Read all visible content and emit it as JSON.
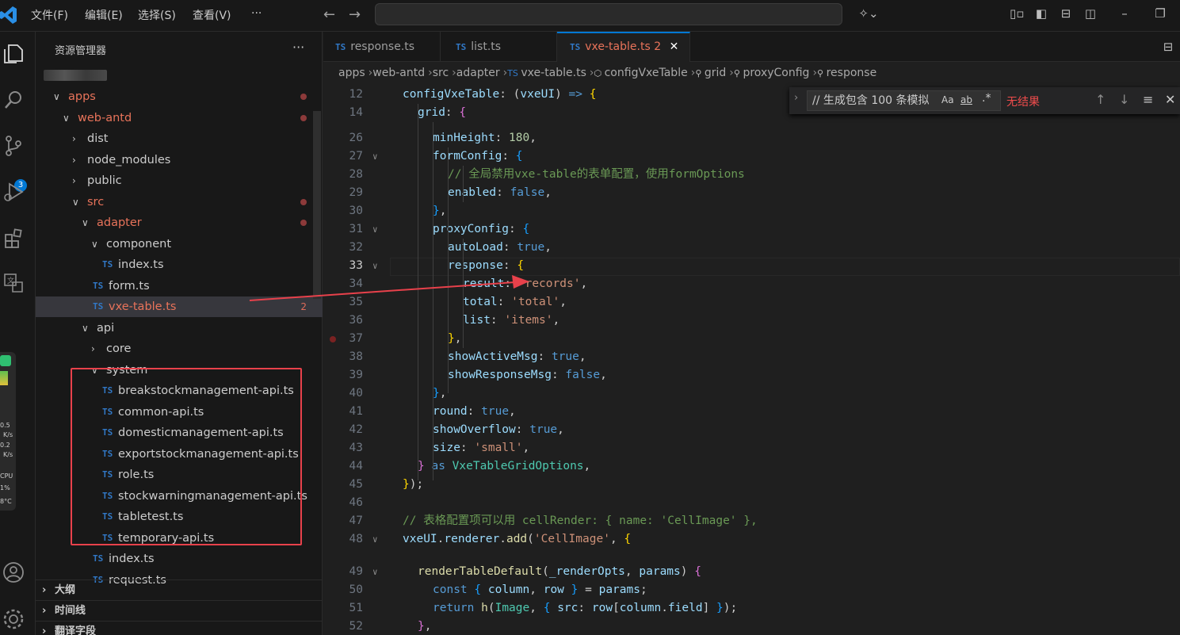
{
  "menu": [
    "文件(F)",
    "编辑(E)",
    "选择(S)",
    "查看(V)",
    "···"
  ],
  "nav": {
    "back": "←",
    "forward": "→"
  },
  "activity_badge": "3",
  "widget": [
    "0.5",
    "K/s",
    "0.2",
    "K/s",
    "CPU",
    "1%",
    "8°C"
  ],
  "sidebar": {
    "title": "资源管理器",
    "more": "···",
    "tree": [
      {
        "label": "apps",
        "chev": "∨",
        "indent": 0,
        "modified": true,
        "dot": true
      },
      {
        "label": "web-antd",
        "chev": "∨",
        "indent": 1,
        "modified": true,
        "dot": true
      },
      {
        "label": "dist",
        "chev": "›",
        "indent": 2
      },
      {
        "label": "node_modules",
        "chev": "›",
        "indent": 2
      },
      {
        "label": "public",
        "chev": "›",
        "indent": 2
      },
      {
        "label": "src",
        "chev": "∨",
        "indent": 2,
        "modified": true,
        "dot": true
      },
      {
        "label": "adapter",
        "chev": "∨",
        "indent": 3,
        "modified": true,
        "dot": true
      },
      {
        "label": "component",
        "chev": "∨",
        "indent": 4
      },
      {
        "label": "index.ts",
        "ts": true,
        "indent": 5
      },
      {
        "label": "form.ts",
        "ts": true,
        "indent": 4
      },
      {
        "label": "vxe-table.ts",
        "ts": true,
        "indent": 4,
        "modified": true,
        "count": "2",
        "selected": true
      },
      {
        "label": "api",
        "chev": "∨",
        "indent": 3
      },
      {
        "label": "core",
        "chev": "›",
        "indent": 4
      },
      {
        "label": "system",
        "chev": "∨",
        "indent": 4
      },
      {
        "label": "breakstockmanagement-api.ts",
        "ts": true,
        "indent": 5
      },
      {
        "label": "common-api.ts",
        "ts": true,
        "indent": 5
      },
      {
        "label": "domesticmanagement-api.ts",
        "ts": true,
        "indent": 5
      },
      {
        "label": "exportstockmanagement-api.ts",
        "ts": true,
        "indent": 5
      },
      {
        "label": "role.ts",
        "ts": true,
        "indent": 5
      },
      {
        "label": "stockwarningmanagement-api.ts",
        "ts": true,
        "indent": 5
      },
      {
        "label": "tabletest.ts",
        "ts": true,
        "indent": 5
      },
      {
        "label": "temporary-api.ts",
        "ts": true,
        "indent": 5
      },
      {
        "label": "index.ts",
        "ts": true,
        "indent": 4
      },
      {
        "label": "request.ts",
        "ts": true,
        "indent": 4
      }
    ],
    "sections": [
      "大纲",
      "时间线",
      "翻译字段"
    ]
  },
  "tabs": [
    {
      "label": "response.ts",
      "active": false
    },
    {
      "label": "list.ts",
      "active": false
    },
    {
      "label": "vxe-table.ts",
      "active": true,
      "count": "2",
      "close": "✕"
    }
  ],
  "breadcrumb": [
    "apps",
    "web-antd",
    "src",
    "adapter",
    "vxe-table.ts",
    "configVxeTable",
    "grid",
    "proxyConfig",
    "response"
  ],
  "find": {
    "query": "// 生成包含 100 条模拟",
    "opt_case": "Aa",
    "opt_word": "ab",
    "opt_regex": ".*",
    "result": "无结果"
  },
  "code": [
    {
      "n": "12",
      "fold": false,
      "indent": 0,
      "html": "<span class='prop'>configVxeTable</span>: (<span class='prop'>vxeUI</span>) <span class='kw'>=&gt;</span> <span class='br1'>{</span>"
    },
    {
      "n": "14",
      "fold": false,
      "indent": 1,
      "html": "<span class='prop'>grid</span>: <span class='br2'>{</span>"
    },
    {
      "n": "26",
      "fold": false,
      "indent": 2,
      "html": "<span class='prop'>minHeight</span>: <span class='num'>180</span>,"
    },
    {
      "n": "27",
      "fold": true,
      "indent": 2,
      "html": "<span class='prop'>formConfig</span>: <span class='br3'>{</span>"
    },
    {
      "n": "28",
      "fold": false,
      "indent": 3,
      "html": "<span class='cmt'>// 全局禁用vxe-table的表单配置，使用formOptions</span>"
    },
    {
      "n": "29",
      "fold": false,
      "indent": 3,
      "html": "<span class='prop'>enabled</span>: <span class='kw'>false</span>,"
    },
    {
      "n": "30",
      "fold": false,
      "indent": 2,
      "html": "<span class='br3'>}</span>,"
    },
    {
      "n": "31",
      "fold": true,
      "indent": 2,
      "html": "<span class='prop'>proxyConfig</span>: <span class='br3'>{</span>"
    },
    {
      "n": "32",
      "fold": false,
      "indent": 3,
      "html": "<span class='prop'>autoLoad</span>: <span class='kw'>true</span>,"
    },
    {
      "n": "33",
      "fold": true,
      "indent": 3,
      "cur": true,
      "html": "<span class='prop'>response</span>: <span class='br1'>{</span>"
    },
    {
      "n": "34",
      "fold": false,
      "indent": 4,
      "html": "<span class='prop'>result</span>: <span class='str'>'records'</span>,"
    },
    {
      "n": "35",
      "fold": false,
      "indent": 4,
      "html": "<span class='prop'>total</span>: <span class='str'>'total'</span>,"
    },
    {
      "n": "36",
      "fold": false,
      "indent": 4,
      "html": "<span class='prop'>list</span>: <span class='str'>'items'</span>,"
    },
    {
      "n": "37",
      "fold": false,
      "indent": 3,
      "html": "<span class='br1'>}</span>,"
    },
    {
      "n": "38",
      "fold": false,
      "indent": 3,
      "html": "<span class='prop'>showActiveMsg</span>: <span class='kw'>true</span>,"
    },
    {
      "n": "39",
      "fold": false,
      "indent": 3,
      "html": "<span class='prop'>showResponseMsg</span>: <span class='kw'>false</span>,"
    },
    {
      "n": "40",
      "fold": false,
      "indent": 2,
      "html": "<span class='br3'>}</span>,"
    },
    {
      "n": "41",
      "fold": false,
      "indent": 2,
      "html": "<span class='prop'>round</span>: <span class='kw'>true</span>,"
    },
    {
      "n": "42",
      "fold": false,
      "indent": 2,
      "html": "<span class='prop'>showOverflow</span>: <span class='kw'>true</span>,"
    },
    {
      "n": "43",
      "fold": false,
      "indent": 2,
      "html": "<span class='prop'>size</span>: <span class='str'>'small'</span>,"
    },
    {
      "n": "44",
      "fold": false,
      "indent": 1,
      "html": "<span class='br2'>}</span> <span class='kw'>as</span> <span class='type'>VxeTableGridOptions</span>,"
    },
    {
      "n": "45",
      "fold": false,
      "indent": 0,
      "html": "<span class='br1'>}</span>);"
    },
    {
      "n": "46",
      "fold": false,
      "indent": 0,
      "html": ""
    },
    {
      "n": "47",
      "fold": false,
      "indent": 0,
      "html": "<span class='cmt'>// 表格配置项可以用 cellRender: { name: 'CellImage' },</span>"
    },
    {
      "n": "48",
      "fold": true,
      "indent": 0,
      "html": "<span class='prop'>vxeUI</span>.<span class='prop'>renderer</span>.<span class='fn'>add</span>(<span class='str'>'CellImage'</span>, <span class='br1'>{</span>"
    },
    {
      "n": "",
      "fold": false,
      "indent": 0,
      "html": ""
    },
    {
      "n": "49",
      "fold": true,
      "indent": 1,
      "html": "<span class='fn'>renderTableDefault</span>(<span class='prop'>_renderOpts</span>, <span class='prop'>params</span>) <span class='br2'>{</span>"
    },
    {
      "n": "50",
      "fold": false,
      "indent": 2,
      "html": "<span class='kw'>const</span> <span class='br3'>{</span> <span class='prop'>column</span>, <span class='prop'>row</span> <span class='br3'>}</span> = <span class='prop'>params</span>;"
    },
    {
      "n": "51",
      "fold": false,
      "indent": 2,
      "html": "<span class='kw'>return</span> <span class='fn'>h</span>(<span class='type'>Image</span>, <span class='br3'>{</span> <span class='prop'>src</span>: <span class='prop'>row</span>[<span class='prop'>column</span>.<span class='prop'>field</span>] <span class='br3'>}</span>);"
    },
    {
      "n": "52",
      "fold": false,
      "indent": 1,
      "html": "<span class='br2'>}</span>,"
    }
  ]
}
